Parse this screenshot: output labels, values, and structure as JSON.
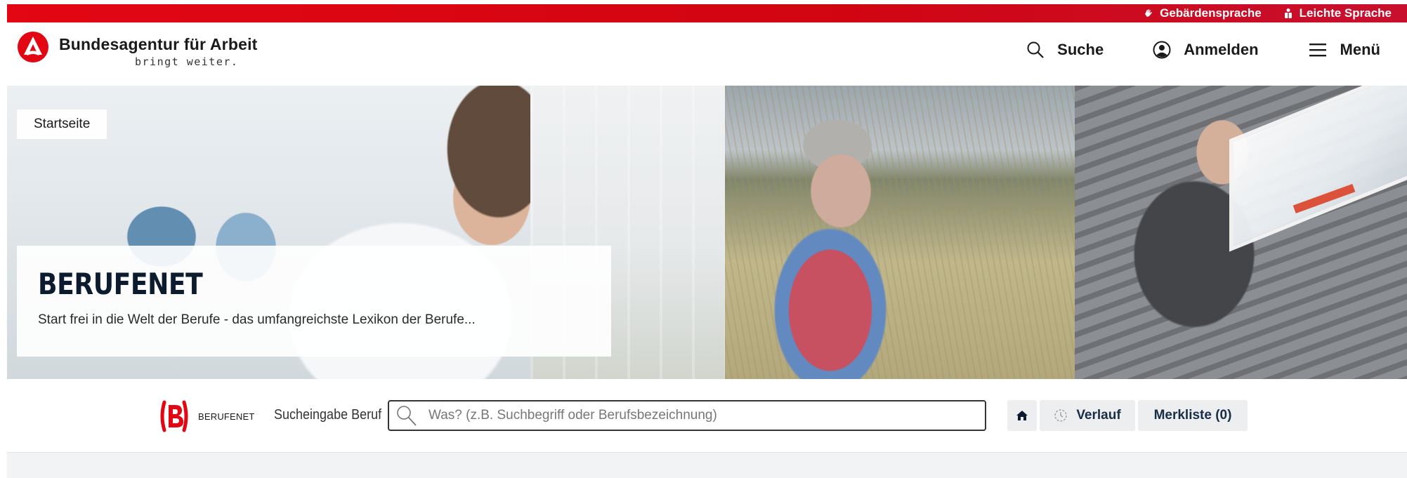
{
  "topbar": {
    "links": [
      {
        "label": "Gebärdensprache",
        "icon": "sign-language-icon"
      },
      {
        "label": "Leichte Sprache",
        "icon": "easy-language-icon"
      }
    ],
    "color": "#e30613"
  },
  "header": {
    "logo_title": "Bundesagentur für Arbeit",
    "logo_tagline": "bringt weiter.",
    "nav": {
      "search_label": "Suche",
      "login_label": "Anmelden",
      "menu_label": "Menü"
    }
  },
  "hero": {
    "breadcrumb": "Startseite",
    "title": "BERUFENET",
    "subtitle": "Start frei in die Welt der Berufe - das umfangreichste Lexikon der Berufe..."
  },
  "searchbar": {
    "brand": "BERUFENET",
    "label": "Sucheingabe Beruf",
    "placeholder": "Was? (z.B. Suchbegriff oder Berufsbezeichnung)",
    "verlauf_label": "Verlauf",
    "merkliste_label": "Merkliste (0)"
  },
  "colors": {
    "brand_red": "#e30613",
    "hero_title": "#0d1b2e",
    "button_text": "#1a2d47"
  }
}
